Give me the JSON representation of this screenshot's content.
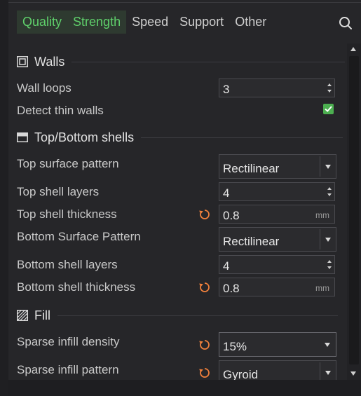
{
  "tabs": [
    {
      "label": "Quality",
      "active": true
    },
    {
      "label": "Strength",
      "active": true
    },
    {
      "label": "Speed",
      "active": false
    },
    {
      "label": "Support",
      "active": false
    },
    {
      "label": "Other",
      "active": false
    }
  ],
  "colors": {
    "accent": "#5fd06b",
    "reset": "#f0803c",
    "background": "#262629"
  },
  "sections": {
    "walls": {
      "title": "Walls",
      "icon": "walls-icon",
      "wall_loops": {
        "label": "Wall loops",
        "value": "3"
      },
      "detect_thin_walls": {
        "label": "Detect thin walls",
        "checked": true
      }
    },
    "shells": {
      "title": "Top/Bottom shells",
      "icon": "shells-icon",
      "top_surface_pattern": {
        "label": "Top surface pattern",
        "value": "Rectilinear"
      },
      "top_shell_layers": {
        "label": "Top shell layers",
        "value": "4"
      },
      "top_shell_thickness": {
        "label": "Top shell thickness",
        "value": "0.8",
        "unit": "mm"
      },
      "bottom_surface_pattern": {
        "label": "Bottom Surface Pattern",
        "value": "Rectilinear"
      },
      "bottom_shell_layers": {
        "label": "Bottom shell layers",
        "value": "4"
      },
      "bottom_shell_thickness": {
        "label": "Bottom shell thickness",
        "value": "0.8",
        "unit": "mm"
      }
    },
    "fill": {
      "title": "Fill",
      "icon": "fill-icon",
      "sparse_infill_density": {
        "label": "Sparse infill density",
        "value": "15%"
      },
      "sparse_infill_pattern": {
        "label": "Sparse infill pattern",
        "value": "Gyroid"
      }
    }
  }
}
